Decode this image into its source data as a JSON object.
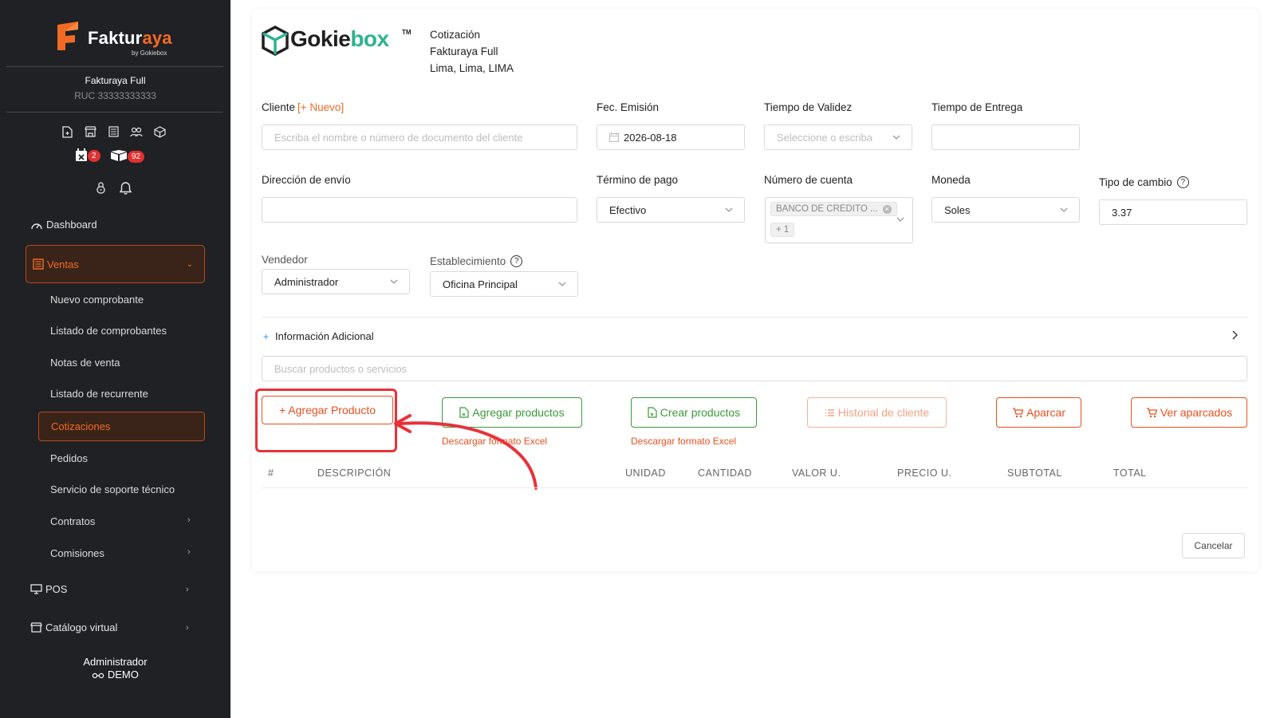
{
  "sidebar": {
    "brand_name_main": "Faktur",
    "brand_name_accent": "aya",
    "brand_sub": "by Gokiebox",
    "company": "Fakturaya Full",
    "ruc": "RUC 33333333333",
    "badges": {
      "calendar": "2",
      "boxes": "92"
    },
    "nav": {
      "dashboard": "Dashboard",
      "ventas": "Ventas",
      "pos": "POS",
      "catalogo": "Catálogo virtual"
    },
    "ventas_items": [
      "Nuevo comprobante",
      "Listado de comprobantes",
      "Notas de venta",
      "Listado de recurrente",
      "Cotizaciones",
      "Pedidos",
      "Servicio de soporte técnico",
      "Contratos",
      "Comisiones"
    ],
    "user_role": "Administrador",
    "user_name": "DEMO"
  },
  "header": {
    "brand_main": "Gokie",
    "brand_accent": "box",
    "brand_tm": "TM",
    "doc_type": "Cotización",
    "company": "Fakturaya Full",
    "location": "Lima, Lima, LIMA"
  },
  "form": {
    "cliente_label": "Cliente",
    "cliente_new": "[+ Nuevo]",
    "cliente_placeholder": "Escriba el nombre o número de documento del cliente",
    "fecha_label": "Fec. Emisión",
    "fecha_value": "2026-08-18",
    "validez_label": "Tiempo de Validez",
    "validez_placeholder": "Seleccione o escriba",
    "entrega_label": "Tiempo de Entrega",
    "entrega_value": "",
    "direccion_label": "Dirección de envío",
    "direccion_value": "",
    "termino_label": "Término de pago",
    "termino_value": "Efectivo",
    "cuenta_label": "Número de cuenta",
    "cuenta_tag": "BANCO DE CREDITO ...",
    "cuenta_more": "+ 1",
    "moneda_label": "Moneda",
    "moneda_value": "Soles",
    "cambio_label": "Tipo de cambio",
    "cambio_value": "3.37",
    "vendedor_label": "Vendedor",
    "vendedor_value": "Administrador",
    "establecimiento_label": "Establecimiento",
    "establecimiento_value": "Oficina Principal",
    "info_adicional": "Información Adicional",
    "search_placeholder": "Buscar productos o servicios"
  },
  "actions": {
    "add_product": "+ Agregar Producto",
    "add_products": "Agregar productos",
    "create_products": "Crear productos",
    "history": "Historial de cliente",
    "park": "Aparcar",
    "view_parked": "Ver aparcados",
    "download_1": "Descargar formato Excel",
    "download_2": "Descargar formato Excel"
  },
  "table": {
    "headers": [
      "#",
      "DESCRIPCIÓN",
      "UNIDAD",
      "CANTIDAD",
      "VALOR U.",
      "PRECIO U.",
      "SUBTOTAL",
      "TOTAL"
    ]
  },
  "footer": {
    "cancel": "Cancelar"
  },
  "colors": {
    "accent": "#f26b24",
    "sidebar_bg": "#202124",
    "green": "#3a9a3a",
    "highlight": "#e8323a"
  }
}
